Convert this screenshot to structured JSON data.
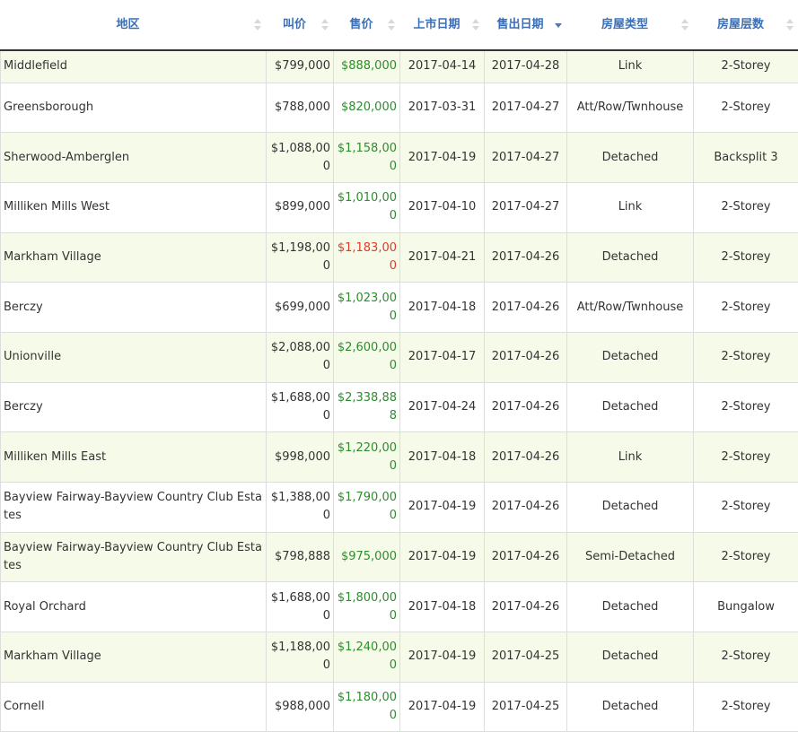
{
  "columns": [
    {
      "label": "地区",
      "sort": "none"
    },
    {
      "label": "叫价",
      "sort": "none"
    },
    {
      "label": "售价",
      "sort": "none"
    },
    {
      "label": "上市日期",
      "sort": "none"
    },
    {
      "label": "售出日期",
      "sort": "desc"
    },
    {
      "label": "房屋类型",
      "sort": "none"
    },
    {
      "label": "房屋层数",
      "sort": "none"
    }
  ],
  "rows": [
    {
      "area": "Middlefield",
      "ask": "$799,000",
      "sold": "$888,000",
      "sold_color": "green",
      "listed": "2017-04-14",
      "sold_date": "2017-04-28",
      "type": "Link",
      "storey": "2-Storey"
    },
    {
      "area": "Greensborough",
      "ask": "$788,000",
      "sold": "$820,000",
      "sold_color": "green",
      "listed": "2017-03-31",
      "sold_date": "2017-04-27",
      "type": "Att/Row/Twnhouse",
      "storey": "2-Storey"
    },
    {
      "area": "Sherwood-Amberglen",
      "ask": "$1,088,000",
      "sold": "$1,158,000",
      "sold_color": "green",
      "listed": "2017-04-19",
      "sold_date": "2017-04-27",
      "type": "Detached",
      "storey": "Backsplit 3"
    },
    {
      "area": "Milliken Mills West",
      "ask": "$899,000",
      "sold": "$1,010,000",
      "sold_color": "green",
      "listed": "2017-04-10",
      "sold_date": "2017-04-27",
      "type": "Link",
      "storey": "2-Storey"
    },
    {
      "area": "Markham Village",
      "ask": "$1,198,000",
      "sold": "$1,183,000",
      "sold_color": "red",
      "listed": "2017-04-21",
      "sold_date": "2017-04-26",
      "type": "Detached",
      "storey": "2-Storey"
    },
    {
      "area": "Berczy",
      "ask": "$699,000",
      "sold": "$1,023,000",
      "sold_color": "green",
      "listed": "2017-04-18",
      "sold_date": "2017-04-26",
      "type": "Att/Row/Twnhouse",
      "storey": "2-Storey"
    },
    {
      "area": "Unionville",
      "ask": "$2,088,000",
      "sold": "$2,600,000",
      "sold_color": "green",
      "listed": "2017-04-17",
      "sold_date": "2017-04-26",
      "type": "Detached",
      "storey": "2-Storey"
    },
    {
      "area": "Berczy",
      "ask": "$1,688,000",
      "sold": "$2,338,888",
      "sold_color": "green",
      "listed": "2017-04-24",
      "sold_date": "2017-04-26",
      "type": "Detached",
      "storey": "2-Storey"
    },
    {
      "area": "Milliken Mills East",
      "ask": "$998,000",
      "sold": "$1,220,000",
      "sold_color": "green",
      "listed": "2017-04-18",
      "sold_date": "2017-04-26",
      "type": "Link",
      "storey": "2-Storey"
    },
    {
      "area": "Bayview Fairway-Bayview Country Club Estates",
      "ask": "$1,388,000",
      "sold": "$1,790,000",
      "sold_color": "green",
      "listed": "2017-04-19",
      "sold_date": "2017-04-26",
      "type": "Detached",
      "storey": "2-Storey"
    },
    {
      "area": "Bayview Fairway-Bayview Country Club Estates",
      "ask": "$798,888",
      "sold": "$975,000",
      "sold_color": "green",
      "listed": "2017-04-19",
      "sold_date": "2017-04-26",
      "type": "Semi-Detached",
      "storey": "2-Storey"
    },
    {
      "area": "Royal Orchard",
      "ask": "$1,688,000",
      "sold": "$1,800,000",
      "sold_color": "green",
      "listed": "2017-04-18",
      "sold_date": "2017-04-26",
      "type": "Detached",
      "storey": "Bungalow"
    },
    {
      "area": "Markham Village",
      "ask": "$1,188,000",
      "sold": "$1,240,000",
      "sold_color": "green",
      "listed": "2017-04-19",
      "sold_date": "2017-04-25",
      "type": "Detached",
      "storey": "2-Storey"
    },
    {
      "area": "Cornell",
      "ask": "$988,000",
      "sold": "$1,180,000",
      "sold_color": "green",
      "listed": "2017-04-19",
      "sold_date": "2017-04-25",
      "type": "Detached",
      "storey": "2-Storey"
    }
  ]
}
